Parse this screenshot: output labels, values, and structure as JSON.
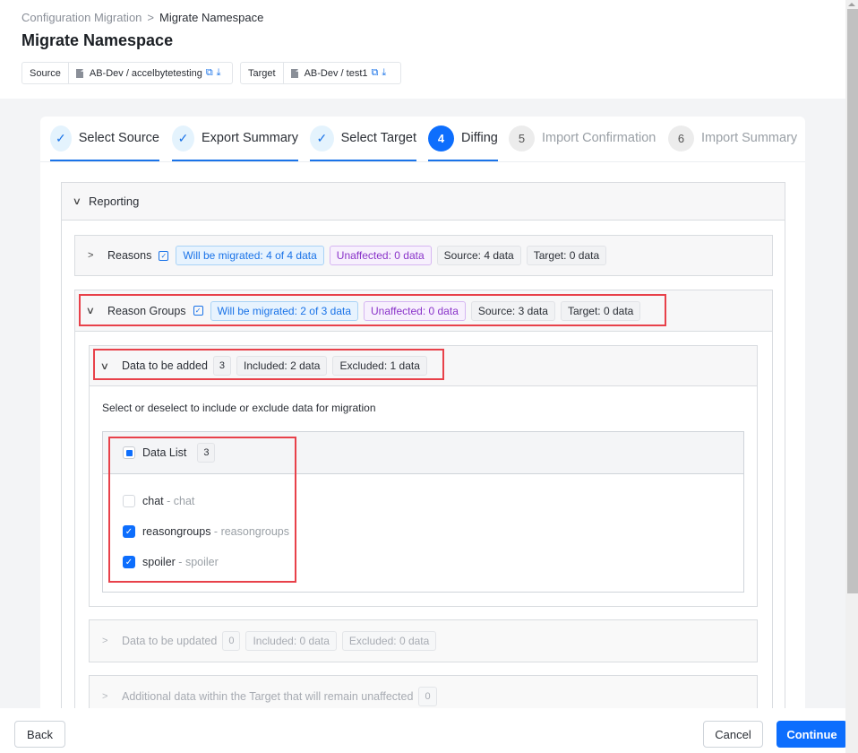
{
  "breadcrumb": {
    "parent": "Configuration Migration",
    "separator": ">",
    "current": "Migrate Namespace"
  },
  "page_title": "Migrate Namespace",
  "namespaces": {
    "source": {
      "label": "Source",
      "value": "AB-Dev / accelbytetesting",
      "icons": [
        "file-icon",
        "external-link-icon",
        "download-icon"
      ]
    },
    "target": {
      "label": "Target",
      "value": "AB-Dev / test1",
      "icons": [
        "file-icon",
        "external-link-icon",
        "download-icon"
      ]
    }
  },
  "stepper": {
    "steps": [
      {
        "marker": "✓",
        "label": "Select Source",
        "state": "done"
      },
      {
        "marker": "✓",
        "label": "Export Summary",
        "state": "done"
      },
      {
        "marker": "✓",
        "label": "Select Target",
        "state": "done"
      },
      {
        "marker": "4",
        "label": "Diffing",
        "state": "active"
      },
      {
        "marker": "5",
        "label": "Import Confirmation",
        "state": "todo"
      },
      {
        "marker": "6",
        "label": "Import Summary",
        "state": "todo"
      }
    ]
  },
  "reporting": {
    "title": "Reporting",
    "expanded": true,
    "sections": {
      "reasons": {
        "title": "Reasons",
        "expanded": false,
        "checked": true,
        "tags": {
          "migrated": {
            "key": "Will be migrated:",
            "value": "4 of 4 data"
          },
          "unaffected": {
            "key": "Unaffected:",
            "value": "0 data"
          },
          "source": {
            "key": "Source:",
            "value": "4 data"
          },
          "target": {
            "key": "Target:",
            "value": "0 data"
          }
        }
      },
      "reason_groups": {
        "title": "Reason Groups",
        "expanded": true,
        "checked": true,
        "tags": {
          "migrated": {
            "key": "Will be migrated:",
            "value": "2 of 3 data"
          },
          "unaffected": {
            "key": "Unaffected:",
            "value": "0 data"
          },
          "source": {
            "key": "Source:",
            "value": "3 data"
          },
          "target": {
            "key": "Target:",
            "value": "0 data"
          }
        },
        "to_be_added": {
          "title": "Data to be added",
          "count": "3",
          "included": {
            "key": "Included:",
            "value": "2 data"
          },
          "excluded": {
            "key": "Excluded:",
            "value": "1 data"
          },
          "instruction": "Select or deselect to include or exclude data for migration",
          "data_list": {
            "title": "Data List",
            "count": "3",
            "select_all_state": "partial",
            "items": [
              {
                "name": "chat",
                "sep": " - ",
                "sub": "chat",
                "checked": false
              },
              {
                "name": "reasongroups",
                "sep": " - ",
                "sub": "reasongroups",
                "checked": true
              },
              {
                "name": "spoiler",
                "sep": " - ",
                "sub": "spoiler",
                "checked": true
              }
            ]
          }
        },
        "to_be_updated": {
          "title": "Data to be updated",
          "count": "0",
          "included": {
            "key": "Included:",
            "value": "0 data"
          },
          "excluded": {
            "key": "Excluded:",
            "value": "0 data"
          }
        },
        "unaffected_additional": {
          "title": "Additional data within the Target that will remain unaffected",
          "count": "0"
        }
      }
    }
  },
  "footer": {
    "back": "Back",
    "cancel": "Cancel",
    "continue": "Continue"
  },
  "colors": {
    "accent": "#0d6efd",
    "highlight": "#e8414a",
    "migrated_tag": "#1a73e8",
    "unaffected_tag": "#8a34c9"
  }
}
